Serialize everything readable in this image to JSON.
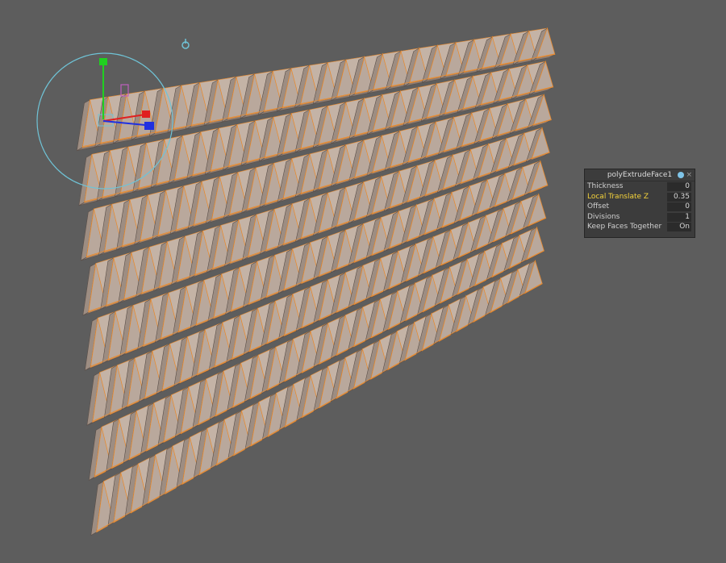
{
  "viewport": {
    "background": "#5d5d5d",
    "mesh_colors": {
      "face": "#b9a89c",
      "face_dark": "#8c7c72",
      "edge_highlight": "#e88a2e"
    }
  },
  "manipulator": {
    "icons": [
      "move-manipulator-icon",
      "rotate-ring-icon",
      "pivot-icon"
    ],
    "axis_colors": {
      "x": "#e02020",
      "y": "#20d020",
      "z": "#2030e0",
      "ring": "#6fc3d6"
    }
  },
  "in_view_editor": {
    "title": "polyExtrudeFace1",
    "icons": [
      "pin-icon",
      "close-icon"
    ],
    "close_glyph": "×",
    "rows": [
      {
        "label": "Thickness",
        "value": "0"
      },
      {
        "label": "Local Translate Z",
        "value": "0.35"
      },
      {
        "label": "Offset",
        "value": "0"
      },
      {
        "label": "Divisions",
        "value": "1"
      },
      {
        "label": "Keep Faces Together",
        "value": "On"
      }
    ]
  }
}
